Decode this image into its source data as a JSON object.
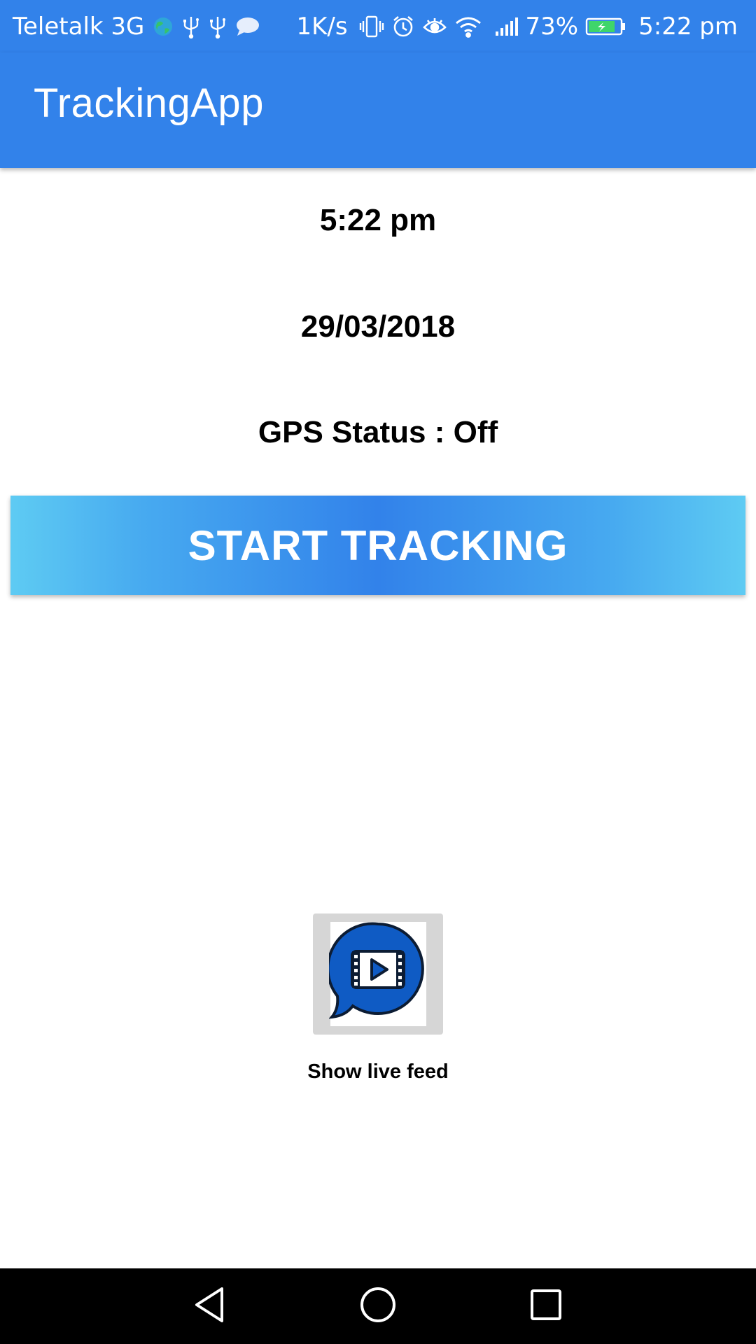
{
  "status_bar": {
    "carrier": "Teletalk 3G",
    "speed": "1K/s",
    "battery_percent": "73%",
    "time": "5:22 pm",
    "icons": [
      "globe-icon",
      "usb-icon",
      "usb-icon",
      "message-icon",
      "vibrate-icon",
      "alarm-icon",
      "eye-icon",
      "wifi-icon",
      "signal-icon",
      "battery-charging-icon"
    ]
  },
  "app_bar": {
    "title": "TrackingApp"
  },
  "main": {
    "time": "5:22 pm",
    "date": "29/03/2018",
    "gps_status": "GPS Status : Off",
    "start_button_label": "START TRACKING",
    "live_feed_label": "Show live feed",
    "live_feed_icon": "video-chat-icon"
  },
  "nav_bar": {
    "icons": [
      "back-icon",
      "home-icon",
      "recents-icon"
    ]
  },
  "colors": {
    "primary": "#3282ea",
    "button_gradient_edge": "#5ecbf3",
    "icon_blue": "#0f5bc4",
    "nav_background": "#000000"
  }
}
